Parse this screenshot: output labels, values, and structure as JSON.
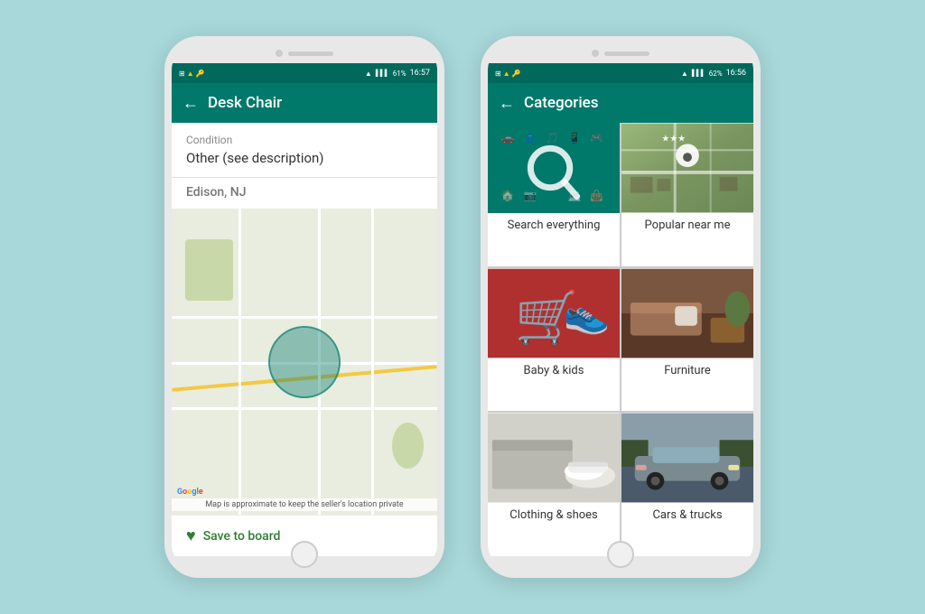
{
  "background_color": "#a8d8da",
  "phone_left": {
    "status_bar": {
      "left_icons": [
        "sim-icon",
        "warning-icon",
        "key-icon"
      ],
      "right_text": "61%",
      "time": "16:57",
      "wifi": true,
      "battery": "61%"
    },
    "app_bar": {
      "back_label": "←",
      "title": "Desk Chair"
    },
    "condition": {
      "label": "Condition",
      "value": "Other (see description)"
    },
    "location": {
      "label": "Edison, NJ"
    },
    "map_caption": "Map is approximate to keep the seller's location private",
    "save_button": "Save to board"
  },
  "phone_right": {
    "status_bar": {
      "right_text": "62%",
      "time": "16:56"
    },
    "app_bar": {
      "back_label": "←",
      "title": "Categories"
    },
    "categories": [
      {
        "id": "search-everything",
        "label": "Search everything"
      },
      {
        "id": "popular-near-me",
        "label": "Popular near me"
      },
      {
        "id": "baby-kids",
        "label": "Baby & kids"
      },
      {
        "id": "furniture",
        "label": "Furniture"
      },
      {
        "id": "clothing-shoes",
        "label": "Clothing & shoes"
      },
      {
        "id": "cars-trucks",
        "label": "Cars & trucks"
      }
    ]
  },
  "icons": {
    "back": "←",
    "heart": "♥",
    "search": "🔍",
    "car": "🚗",
    "tshirt": "👕",
    "stroller": "🍼",
    "couch": "🛋",
    "shoe": "👟"
  }
}
